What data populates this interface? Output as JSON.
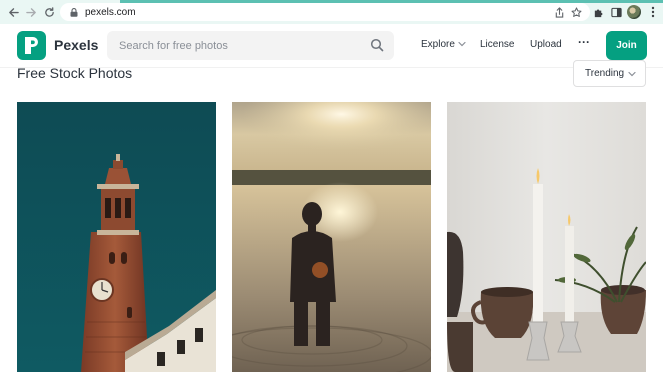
{
  "browser": {
    "url": "pexels.com",
    "colors": {
      "chrome_bg": "#eaf7f4",
      "accent": "#1fa896"
    }
  },
  "header": {
    "brand": "Pexels",
    "search_placeholder": "Search for free photos",
    "nav": {
      "explore": "Explore",
      "license": "License",
      "upload": "Upload",
      "more": "···"
    },
    "join_label": "Join",
    "colors": {
      "brand": "#05a081"
    }
  },
  "main": {
    "title": "Free Stock Photos",
    "sort": {
      "selected": "Trending"
    },
    "photos": [
      {
        "subject": "brick-clock-tower-teal-sky"
      },
      {
        "subject": "silhouette-person-in-water-sunset"
      },
      {
        "subject": "white-candles-and-ceramic-cups"
      }
    ]
  }
}
